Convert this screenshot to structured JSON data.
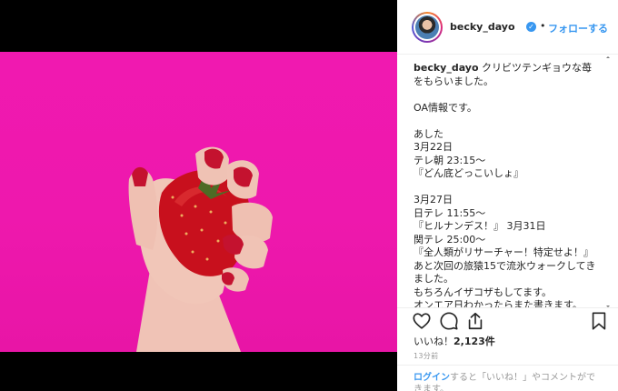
{
  "post": {
    "username": "becky_dayo",
    "follow_label": "フォローする",
    "dot": "•",
    "caption_lines": [
      "クリビツテンギョウな苺をもらいました。",
      "",
      "OA情報です。",
      "",
      "あした",
      "3月22日",
      "テレ朝 23:15〜",
      "『どん底どっこいしょ』",
      "",
      "3月27日",
      "日テレ 11:55〜",
      "『ヒルナンデス！』 3月31日",
      "関テレ 25:00〜",
      "『全人類がリサーチャー！特定せよ！』 あと次回の旅猿15で流氷ウォークしてきました。",
      "もちろんイザコザもしてます。",
      "オンエア日わかったらまた書きます。"
    ],
    "likes_prefix": "いいね！",
    "likes_count": "2,123件",
    "time_ago": "13分前",
    "login_link": "ログイン",
    "login_rest": "すると「いいね！」やコメントができます。"
  },
  "icons": {
    "like": "heart-icon",
    "comment": "comment-icon",
    "share": "share-icon",
    "save": "bookmark-icon",
    "verified": "verified-badge-icon"
  },
  "colors": {
    "accent": "#3897f0",
    "photo_bg": "#ee18ad",
    "text": "#262626",
    "muted": "#999999"
  }
}
